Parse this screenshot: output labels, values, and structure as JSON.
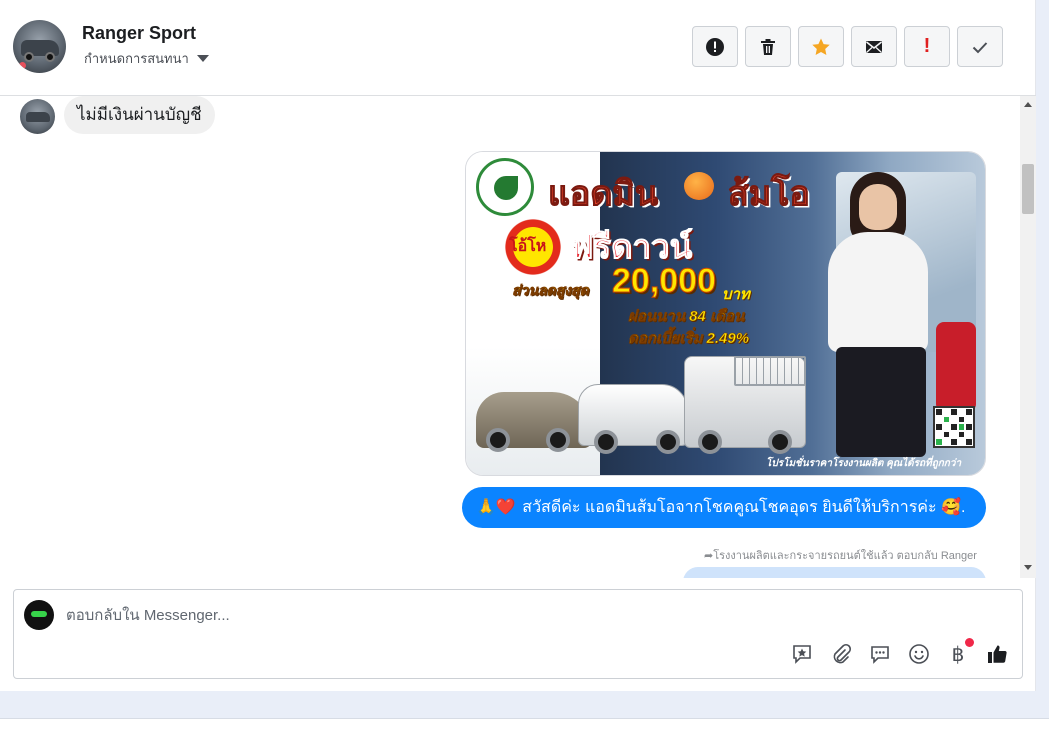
{
  "header": {
    "page_name": "Ranger Sport",
    "assign_label": "กำหนดการสนทนา",
    "toolbar": [
      {
        "name": "report-button",
        "icon": "alert-circle-icon"
      },
      {
        "name": "delete-button",
        "icon": "trash-icon"
      },
      {
        "name": "star-button",
        "icon": "star-icon"
      },
      {
        "name": "mark-unread-button",
        "icon": "envelope-icon"
      },
      {
        "name": "spam-button",
        "icon": "exclamation-icon"
      },
      {
        "name": "done-button",
        "icon": "check-icon"
      }
    ],
    "colors": {
      "star": "#f5a623",
      "spam": "#e02020"
    }
  },
  "messages": {
    "incoming_1": "ไม่มีเงินผ่านบัญชี",
    "promo": {
      "headline_1": "แอดมิน",
      "headline_2": "ส้มโอ",
      "burst": "โอ้โห",
      "free_down": "ฟรีดาวน์",
      "discount_label": "ส่วนลดสูงสุด",
      "discount_amount": "20,000",
      "discount_unit": "บาท",
      "installment": "ผ่อนนาน 84 เดือน",
      "interest": "ดอกเบี้ยเริ่ม 2.49%",
      "footer": "โปรโมชั่นราคาโรงงานผลิต คุณได้รถที่ถูกกว่า"
    },
    "outgoing_1": {
      "emoji_prefix": "🙏❤️",
      "text": "สวัสดีค่ะ แอดมินส้มโอจากโชคคูณโชคอุดร ยินดีให้บริการค่ะ",
      "emoji_suffix": "🥰."
    },
    "meta_line": "โรงงานผลิตและกระจายรถยนต์ใช้แล้ว ตอบกลับ Ranger"
  },
  "composer": {
    "placeholder": "ตอบกลับใน Messenger...",
    "tools": [
      "saved-reply-icon",
      "attachment-icon",
      "chat-bubbles-icon",
      "emoji-icon",
      "baht-icon",
      "thumbs-up-icon"
    ],
    "baht_symbol": "฿"
  }
}
